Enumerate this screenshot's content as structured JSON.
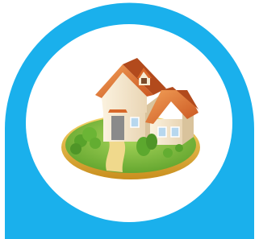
{
  "icon": {
    "name": "home-icon",
    "colors": {
      "frame": "#1ab0ec",
      "background": "#ffffff",
      "roof": "#d8682a",
      "wall": "#f6ead2",
      "lawn": "#7dbb3a",
      "ring": "#e8b640",
      "path": "#f0d98c"
    }
  }
}
